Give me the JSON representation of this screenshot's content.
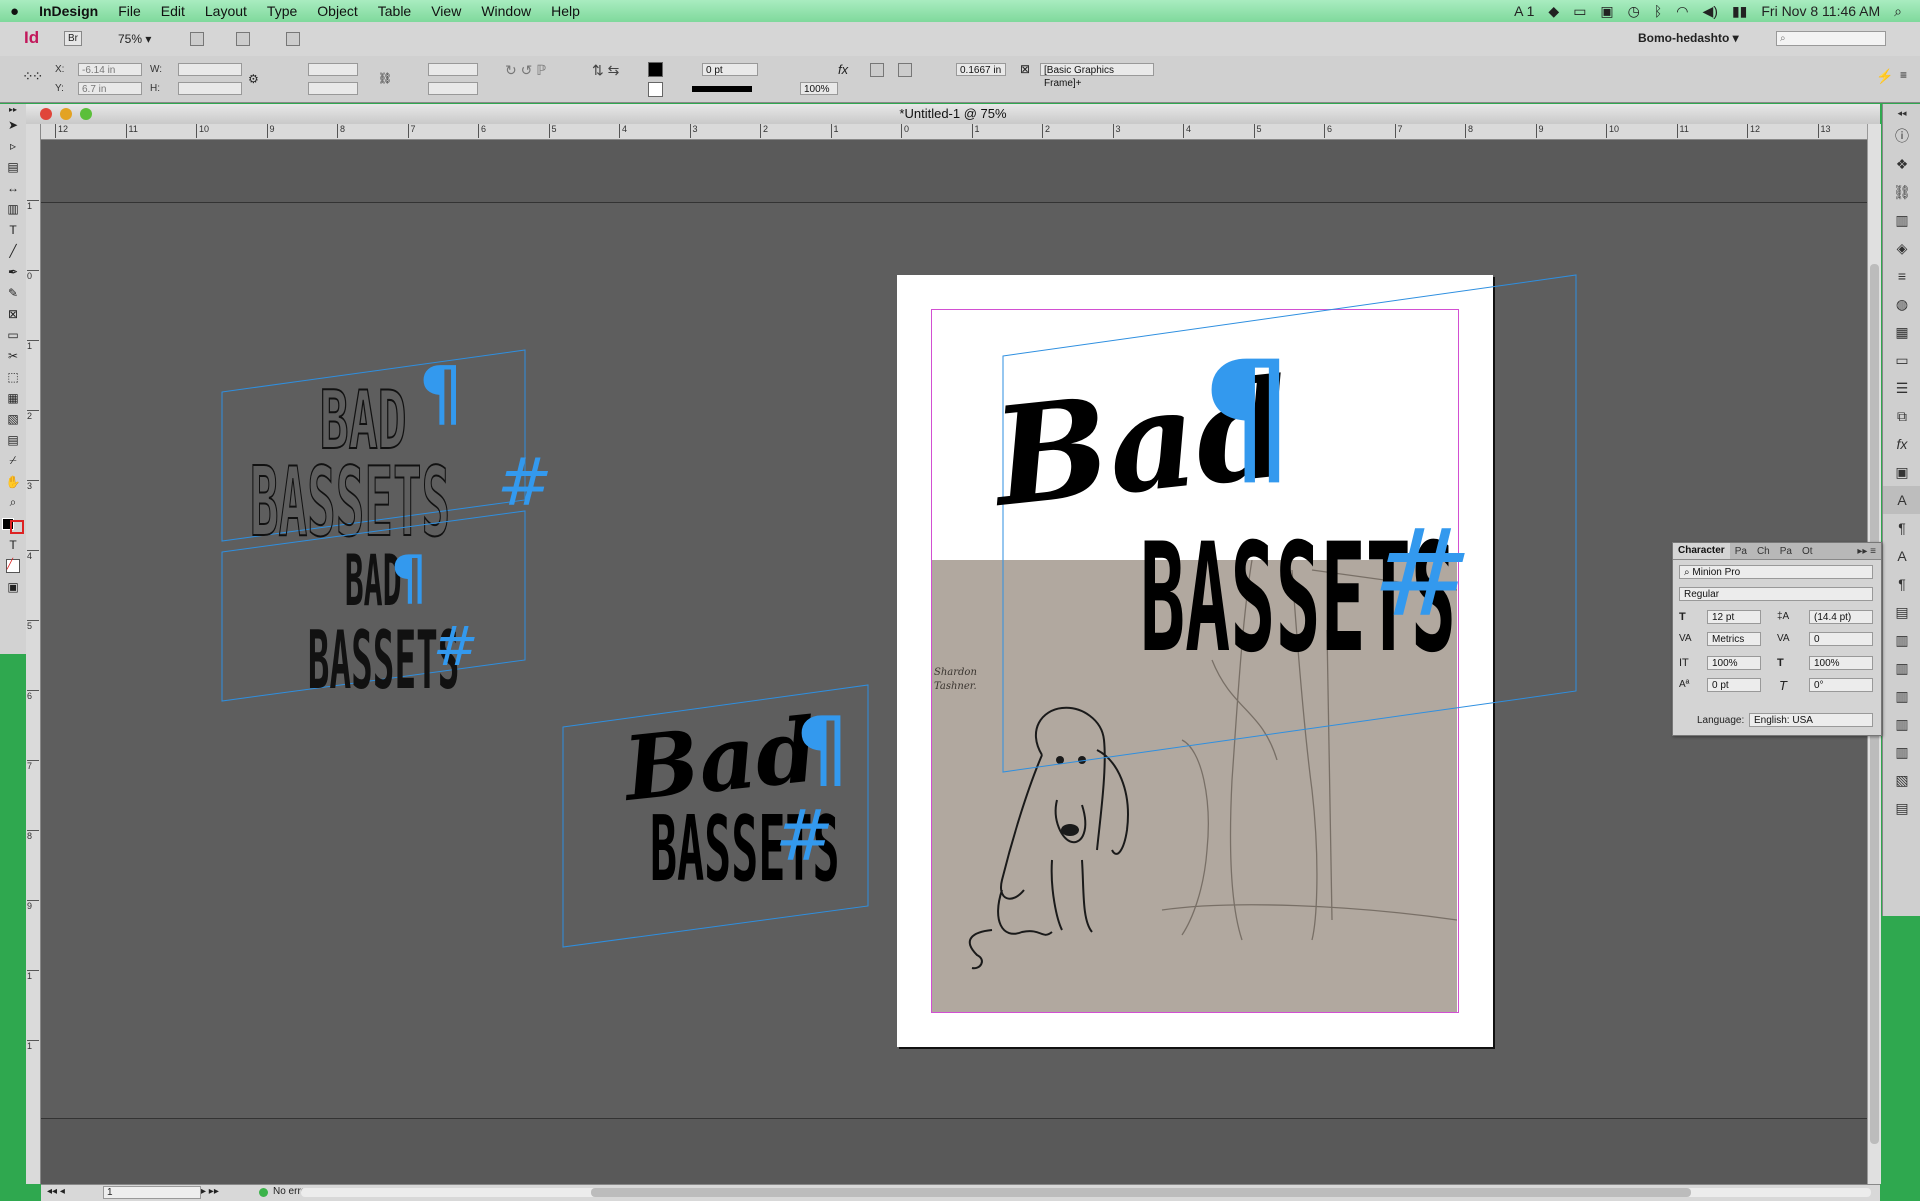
{
  "menubar": {
    "apple": "",
    "app": "InDesign",
    "items": [
      "File",
      "Edit",
      "Layout",
      "Type",
      "Object",
      "Table",
      "View",
      "Window",
      "Help"
    ],
    "status_num": "1",
    "clock": "Fri Nov 8  11:46 AM"
  },
  "appbar": {
    "logo": "Id",
    "bridge": "Br",
    "zoom": "75%",
    "workspace": "Bomo-hedashto"
  },
  "control": {
    "x_label": "X:",
    "x_value": "-6.14 in",
    "y_label": "Y:",
    "y_value": "6.7 in",
    "w_label": "W:",
    "h_label": "H:",
    "stroke_weight": "0 pt",
    "opacity": "100%",
    "fitting": "0.1667 in",
    "object_style": "[Basic Graphics Frame]+"
  },
  "window": {
    "title": "*Untitled-1 @ 75%"
  },
  "rulers": {
    "h_ticks": [
      "12",
      "11",
      "10",
      "9",
      "8",
      "7",
      "6",
      "5",
      "4",
      "3",
      "2",
      "1",
      "0",
      "1",
      "2",
      "3",
      "4",
      "5",
      "6",
      "7",
      "8",
      "9",
      "10",
      "11",
      "12",
      "13"
    ],
    "v_ticks": [
      "1",
      "0",
      "1",
      "2",
      "3",
      "4",
      "5",
      "6",
      "7",
      "8",
      "9",
      "1",
      "1"
    ]
  },
  "artwork": {
    "bad": "Bad",
    "bad_caps": "BAD",
    "bassets": "BASSETS",
    "pilcrow": "¶",
    "hash": "#",
    "sketch_note": "Shardon Tashner.",
    "blue": "#3399ee"
  },
  "character_panel": {
    "title": "Character",
    "tabs": [
      "Pa",
      "Ch",
      "Pa",
      "Ot"
    ],
    "font": "Minion Pro",
    "style": "Regular",
    "size": "12 pt",
    "leading": "(14.4 pt)",
    "kerning": "Metrics",
    "tracking": "0",
    "vscale": "100%",
    "hscale": "100%",
    "baseline": "0 pt",
    "skew": "0°",
    "language_label": "Language:",
    "language": "English: USA"
  },
  "status": {
    "page": "1",
    "preflight": "No errors"
  }
}
